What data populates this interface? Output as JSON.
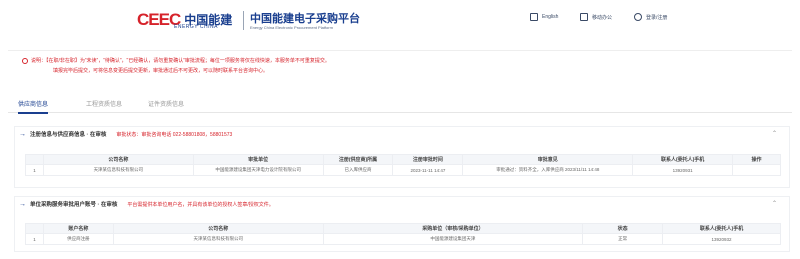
{
  "header": {
    "logo_mark": "CEEC",
    "logo_cn": "中国能建",
    "logo_en": "ENERGY CHINA",
    "platform_title": "中国能建电子采购平台",
    "platform_sub": "Energy China Electronic Procurement Platform",
    "links": [
      {
        "label": "English",
        "icon": "document-icon"
      },
      {
        "label": "移动办公",
        "icon": "mobile-icon"
      },
      {
        "label": "登录/注册",
        "icon": "user-icon"
      }
    ]
  },
  "notice": {
    "line1": "说明：【在职/非在职】为“未读”，“待确认”，“已经确认，请勿重复确认”审批流程；每位一项服务将仅在线快速，本服务单不可重复提交。",
    "line2": "填报完毕后提交，可将信息变更后提交更新，审批通过后不可更改，可以随时联系平台咨询中心。"
  },
  "tabs": [
    {
      "label": "供应商信息"
    },
    {
      "label": "工程资质信息"
    },
    {
      "label": "证件资质信息"
    }
  ],
  "panel1": {
    "title": "注册信息与供应商信息 · 在审核",
    "note": "审批状态：审批咨询电话 022-58801808，58801573",
    "columns": [
      "",
      "公司名称",
      "审批单位",
      "注册(供应商)所属",
      "注册审批时间",
      "审批意见",
      "联系人(委托人)手机",
      "操作"
    ],
    "rows": [
      [
        "1",
        "天津某信息科技有限公司",
        "中国能源建设集团天津电力设计院有限公司",
        "已入库供应商",
        "2023-11-11 14:47",
        "审批通过：资料齐全，入库供应商 2023/11/11 14:48",
        "13920931",
        ""
      ]
    ]
  },
  "panel2": {
    "title": "单位采购服务审批用户账号 · 在审核",
    "note": "平台需提供本单位用户名，并具有该单位的授权人签章/授权文件。",
    "columns": [
      "",
      "账户名称",
      "公司名称",
      "采购单位（审核/采购单位）",
      "状态",
      "联系人(委托人)手机"
    ],
    "rows": [
      [
        "1",
        "供应商注册",
        "天津某信息科技有限公司",
        "中国能源建设集团天津",
        "正常",
        "13920932"
      ]
    ]
  }
}
